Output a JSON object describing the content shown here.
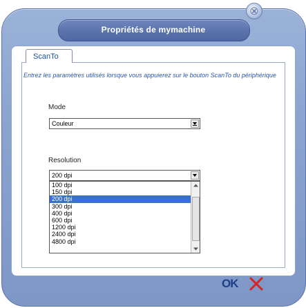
{
  "dialog": {
    "title": "Propriétés de mymachine"
  },
  "tabs": [
    {
      "label": "ScanTo"
    }
  ],
  "description": "Entrez les paramètres utilisés lorsque vous appuierez sur le bouton ScanTo du périphérique",
  "mode": {
    "label": "Mode",
    "value": "Couleur"
  },
  "resolution": {
    "label": "Resolution",
    "value": "200 dpi",
    "options": [
      "100 dpi",
      "150 dpi",
      "200 dpi",
      "300 dpi",
      "400 dpi",
      "600 dpi",
      "1200 dpi",
      "2400 dpi",
      "4800 dpi"
    ],
    "selected_index": 2
  },
  "footer": {
    "ok_label": "OK"
  },
  "colors": {
    "accent": "#3a6fd8",
    "title_bar": "#5b73ad",
    "cancel_red": "#d42424"
  }
}
